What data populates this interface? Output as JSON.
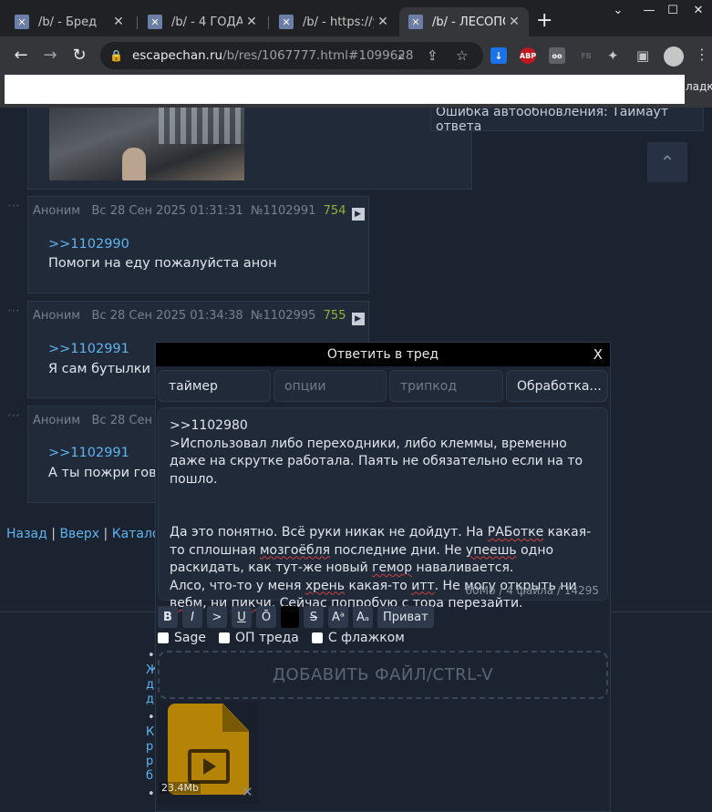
{
  "browser": {
    "tabs": [
      {
        "title": "/b/ - Бред",
        "active": false
      },
      {
        "title": "/b/ - 4 ГОДА",
        "active": false
      },
      {
        "title": "/b/ - https://yo",
        "active": false
      },
      {
        "title": "/b/ - ЛЕСОПО",
        "active": true
      }
    ],
    "new_tab": "+",
    "window_controls": [
      "⌄",
      "—",
      "☐",
      "✕"
    ],
    "url_host": "escapechan.ru",
    "url_path": "/b/res/1067777.html#1099628",
    "extensions": [
      {
        "name": "download-ext-icon",
        "label": "↓",
        "color": "#1a73e8"
      },
      {
        "name": "abp-ext-icon",
        "label": "ABP",
        "color": "#c0181f"
      },
      {
        "name": "oo-ext-icon",
        "label": "oo",
        "color": "#5f6368"
      },
      {
        "name": "fb-ext-icon",
        "label": "FB",
        "color": "#35363a"
      }
    ],
    "bookmarks_right": "ладки"
  },
  "page": {
    "autoupdate_error": "Ошибка автообновления: Таймаут ответа",
    "up_button": "⌃",
    "posts": [
      {
        "author": "Аноним",
        "date": "Вс 28 Сен 2025 01:31:31",
        "number": "№1102991",
        "count": "754",
        "reply_to": ">>1102990",
        "text": "Помоги на еду пожалуйста анон"
      },
      {
        "author": "Аноним",
        "date": "Вс 28 Сен 2025 01:34:38",
        "number": "№1102995",
        "count": "755",
        "reply_to": ">>1102991",
        "text": "Я сам бутылки"
      },
      {
        "author": "Аноним",
        "date": "Вс 28 Сен",
        "number": "",
        "count": "",
        "reply_to": ">>1102991",
        "text": "А ты пожри гов"
      }
    ],
    "bottom_nav": {
      "back": "Назад",
      "up": "Вверх",
      "catalog": "Катало",
      "sep": "|"
    },
    "side_list_letters": [
      "Ж",
      "д",
      "д",
      "",
      "К",
      "р",
      "р",
      "б"
    ]
  },
  "reply": {
    "title": "Ответить в тред",
    "close": "X",
    "timer": "таймер",
    "options_placeholder": "опции",
    "tripcode_placeholder": "трипкод",
    "processing_button": "Обработка...",
    "message_lines": [
      ">>1102980",
      ">Использовал либо переходники, либо клеммы, временно даже на скрутке работала. Паять не обязательно если на то пошло.",
      "",
      "",
      "Да это понятно. Всё руки никак не дойдут. На РАБотке какая-то сплошная мозгоёбля последние дни. Не упеешь одно раскидать, как тут-же новый гемор наваливается.",
      "Алсо, что-то у меня хрень какая-то итт. Не могу открыть ни вебм, ни пикчи. Сейчас попробую с тора перезайти."
    ],
    "counter": "60Mb / 4 файла / 14295",
    "format_buttons": [
      "B",
      "I",
      ">",
      "U",
      "Ō",
      "",
      "S",
      "Aᵃ",
      "Aₐ",
      "Приват"
    ],
    "checkboxes": [
      "Sage",
      "ОП треда",
      "С флажком"
    ],
    "dropzone": "ДОБАВИТЬ ФАЙЛ/CTRL-V",
    "attachment_size": "23.4Mb",
    "attachment_remove": "✕"
  }
}
